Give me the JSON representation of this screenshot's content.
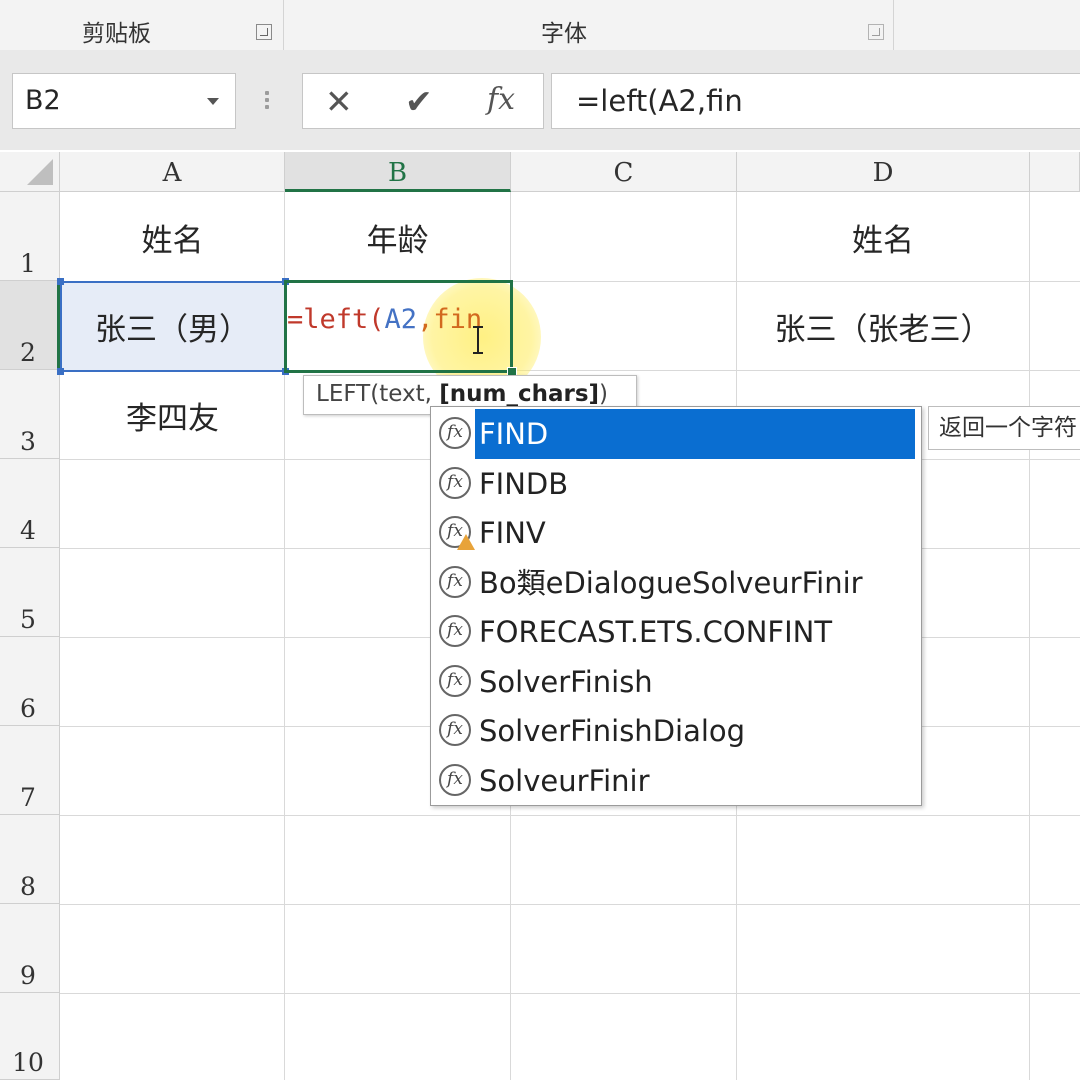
{
  "ribbon": {
    "groups": [
      {
        "label": "剪贴板"
      },
      {
        "label": "字体"
      }
    ]
  },
  "formula_bar": {
    "name_box": "B2",
    "cancel_icon": "✕",
    "enter_icon": "✔",
    "function_icon": "fx",
    "formula": "=left(A2,fin"
  },
  "grid": {
    "columns": [
      "A",
      "B",
      "C",
      "D"
    ],
    "selected_column": "B",
    "rows": [
      "1",
      "2",
      "3",
      "4",
      "5",
      "6",
      "7",
      "8",
      "9",
      "10"
    ],
    "selected_row": "2",
    "cells": {
      "A1": "姓名",
      "B1": "年龄",
      "D1": "姓名",
      "A2": "张三（男）",
      "D2": "张三（张老三）",
      "A3": "李四友"
    },
    "active_cell": "B2",
    "editing": {
      "op": "=left(",
      "ref": "A2",
      "sep": ",",
      "arg": "fin"
    }
  },
  "argument_tooltip": {
    "prefix": "LEFT(text, ",
    "bold": "[num_chars]",
    "suffix": ")"
  },
  "autocomplete": {
    "selected_index": 0,
    "items": [
      {
        "label": "FIND",
        "icon": "function-icon"
      },
      {
        "label": "FINDB",
        "icon": "function-icon"
      },
      {
        "label": "FINV",
        "icon": "function-warning-icon"
      },
      {
        "label": "Bo類eDialogueSolveurFinir",
        "icon": "function-icon"
      },
      {
        "label": "FORECAST.ETS.CONFINT",
        "icon": "function-icon"
      },
      {
        "label": "SolverFinish",
        "icon": "function-icon"
      },
      {
        "label": "SolverFinishDialog",
        "icon": "function-icon"
      },
      {
        "label": "SolveurFinir",
        "icon": "function-icon"
      }
    ],
    "icon_glyph": "fx"
  },
  "description_tooltip": "返回一个字符"
}
